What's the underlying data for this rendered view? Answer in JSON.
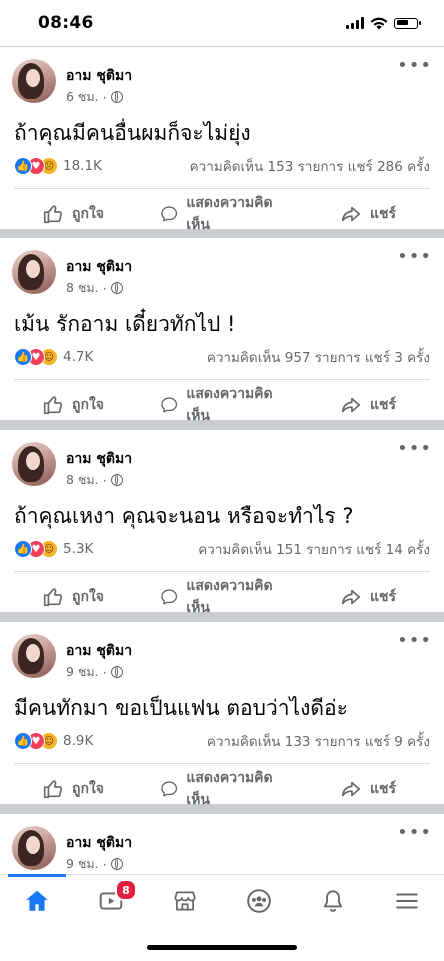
{
  "status": {
    "time": "08:46"
  },
  "posts": [
    {
      "author": "อาม ชุติมา",
      "time": "6 ชม.",
      "text": "ถ้าคุณมีคนอื่นผมก็จะไม่ยุ่ง",
      "reaction_count": "18.1K",
      "counts": "ความคิดเห็น 153 รายการ  แชร์ 286 ครั้ง",
      "third_reaction": "sad"
    },
    {
      "author": "อาม ชุติมา",
      "time": "8 ชม.",
      "text": "เม้น รักอาม เดี๋ยวทักไป !",
      "reaction_count": "4.7K",
      "counts": "ความคิดเห็น 957 รายการ  แชร์ 3 ครั้ง",
      "third_reaction": "haha"
    },
    {
      "author": "อาม ชุติมา",
      "time": "8 ชม.",
      "text": "ถ้าคุณเหงา คุณจะนอน หรือจะทำไร ?",
      "reaction_count": "5.3K",
      "counts": "ความคิดเห็น 151 รายการ  แชร์ 14 ครั้ง",
      "third_reaction": "haha"
    },
    {
      "author": "อาม ชุติมา",
      "time": "9 ชม.",
      "text": "มีคนทักมา ขอเป็นแฟน ตอบว่าไงดีอ่ะ",
      "reaction_count": "8.9K",
      "counts": "ความคิดเห็น 133 รายการ  แชร์ 9 ครั้ง",
      "third_reaction": "haha"
    }
  ],
  "partial_post": {
    "author": "อาม ชุติมา",
    "time": "9 ชม."
  },
  "actions": {
    "like": "ถูกใจ",
    "comment": "แสดงความคิดเห็น",
    "share": "แชร์"
  },
  "tabbar": {
    "video_badge": "8",
    "items": [
      "home-icon",
      "video-icon",
      "marketplace-icon",
      "groups-icon",
      "bell-icon",
      "menu-icon"
    ]
  },
  "colors": {
    "accent": "#1877f2",
    "love": "#f33e58",
    "badge": "#e41e3f"
  }
}
